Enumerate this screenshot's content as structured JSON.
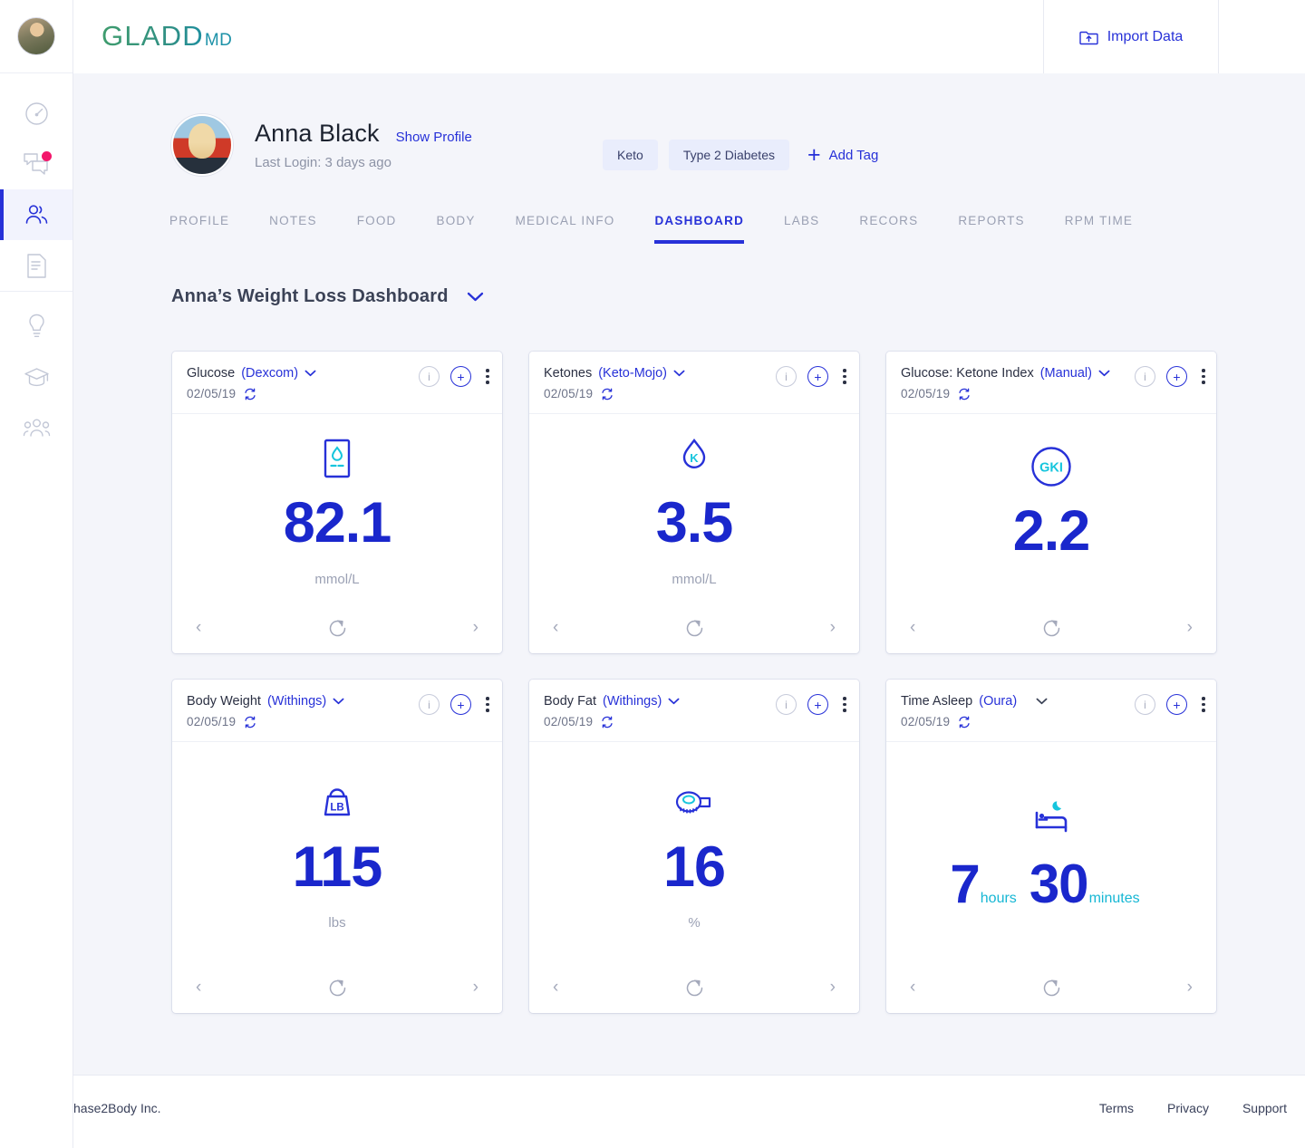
{
  "header": {
    "logo_main": "GLADD",
    "logo_sub": "MD",
    "import_label": "Import Data",
    "import_icon": "folder-upload-icon"
  },
  "sidebar": {
    "items": [
      {
        "name": "avatar",
        "icon": "user-avatar"
      },
      {
        "name": "dashboard",
        "icon": "speedometer-icon"
      },
      {
        "name": "messages",
        "icon": "chat-bubbles-icon",
        "badge": true
      },
      {
        "name": "patients",
        "icon": "people-icon",
        "active": true
      },
      {
        "name": "documents",
        "icon": "document-icon"
      },
      {
        "name": "insights",
        "icon": "lightbulb-icon"
      },
      {
        "name": "education",
        "icon": "graduation-cap-icon"
      },
      {
        "name": "community",
        "icon": "group-icon"
      }
    ]
  },
  "profile": {
    "name": "Anna Black",
    "show_profile": "Show Profile",
    "last_login": "Last Login: 3 days ago",
    "tags": [
      "Keto",
      "Type 2 Diabetes"
    ],
    "add_tag": "Add Tag"
  },
  "tabs": [
    {
      "label": "PROFILE",
      "active": false
    },
    {
      "label": "NOTES",
      "active": false
    },
    {
      "label": "FOOD",
      "active": false
    },
    {
      "label": "BODY",
      "active": false
    },
    {
      "label": "MEDICAL INFO",
      "active": false
    },
    {
      "label": "DASHBOARD",
      "active": true
    },
    {
      "label": "LABS",
      "active": false
    },
    {
      "label": "RECORS",
      "active": false
    },
    {
      "label": "REPORTS",
      "active": false
    },
    {
      "label": "RPM TIME",
      "active": false
    }
  ],
  "dashboard": {
    "title": "Anna’s Weight Loss Dashboard",
    "cards": [
      {
        "title": "Glucose",
        "source": "(Dexcom)",
        "date": "02/05/19",
        "icon": "glucose-meter-icon",
        "value": "82.1",
        "unit": "mmol/L"
      },
      {
        "title": "Ketones",
        "source": "(Keto-Mojo)",
        "date": "02/05/19",
        "icon": "ketone-drop-icon",
        "value": "3.5",
        "unit": "mmol/L"
      },
      {
        "title": "Glucose: Ketone Index",
        "source": "(Manual)",
        "date": "02/05/19",
        "icon": "gki-circle-icon",
        "value": "2.2",
        "unit": ""
      },
      {
        "title": "Body Weight",
        "source": "(Withings)",
        "date": "02/05/19",
        "icon": "weight-lb-icon",
        "value": "115",
        "unit": "lbs"
      },
      {
        "title": "Body Fat",
        "source": "(Withings)",
        "date": "02/05/19",
        "icon": "tape-measure-icon",
        "value": "16",
        "unit": "%"
      },
      {
        "title": "Time Asleep",
        "source": "(Oura)",
        "date": "02/05/19",
        "icon": "bed-moon-icon",
        "hours": "7",
        "hours_unit": "hours",
        "minutes": "30",
        "minutes_unit": "minutes"
      }
    ],
    "card_actions": {
      "info": "i",
      "add": "+",
      "menu": "kebab-icon",
      "prev": "‹",
      "next": "›",
      "refresh": "refresh-icon",
      "sync": "sync-icon"
    }
  },
  "footer": {
    "company": "hase2Body Inc.",
    "links": [
      "Terms",
      "Privacy",
      "Support"
    ]
  },
  "colors": {
    "accent_blue": "#2731d8",
    "value_blue": "#1a27cc",
    "cyan": "#16b7d4",
    "badge_pink": "#f3176b",
    "page_bg": "#f4f5fa"
  }
}
